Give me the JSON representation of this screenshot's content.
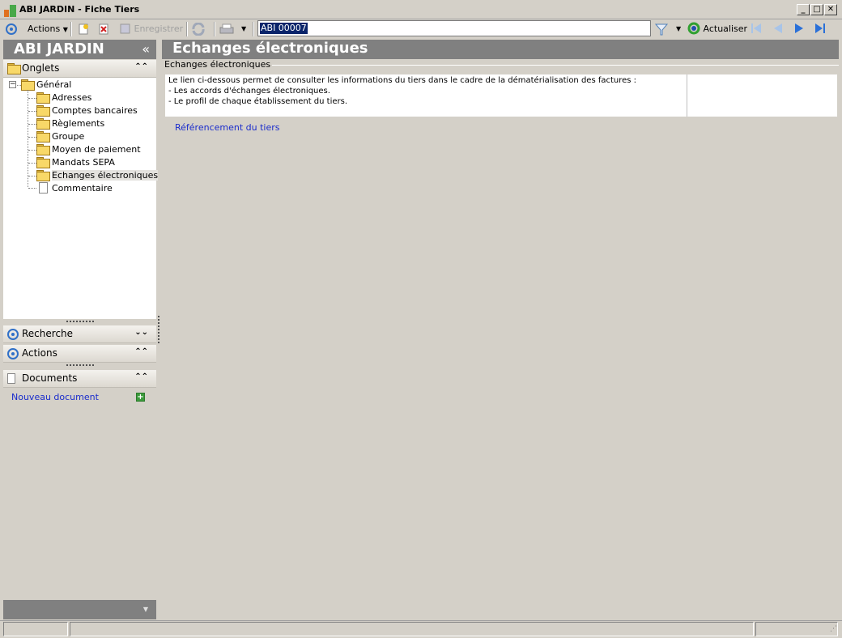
{
  "window": {
    "title": "ABI JARDIN - Fiche Tiers",
    "minimize": "_",
    "maximize": "□",
    "close": "✕"
  },
  "toolbar": {
    "actions_label": "Actions",
    "save_label": "Enregistrer",
    "search_value": "ABI 00007",
    "refresh_label": "Actualiser"
  },
  "left": {
    "header_title": "ABI JARDIN",
    "collapse_glyph": "«",
    "onglets_label": "Onglets",
    "tree": {
      "root": "Général",
      "items": [
        "Adresses",
        "Comptes bancaires",
        "Règlements",
        "Groupe",
        "Moyen de paiement",
        "Mandats SEPA",
        "Echanges électroniques",
        "Commentaire"
      ]
    },
    "recherche_label": "Recherche",
    "actions_label": "Actions",
    "documents_label": "Documents",
    "new_document_label": "Nouveau document"
  },
  "main": {
    "title": "Echanges électroniques",
    "group_title": "Echanges électroniques",
    "info_text": "Le lien ci-dessous permet de consulter les informations du tiers dans le cadre de la dématérialisation des factures :\n- Les accords d'échanges électroniques.\n- Le profil de chaque établissement du tiers.",
    "ref_link": "Référencement du tiers"
  },
  "colors": {
    "header_gray": "#808080",
    "link_blue": "#1a2ccc",
    "background": "#d4d0c8"
  }
}
